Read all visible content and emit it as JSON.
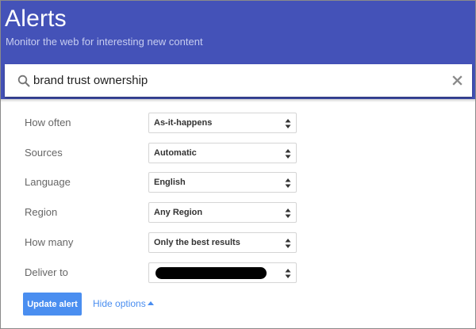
{
  "header": {
    "title": "Alerts",
    "subtitle": "Monitor the web for interesting new content"
  },
  "search": {
    "value": "brand trust ownership",
    "icon": "search-icon",
    "clear_icon": "close-icon"
  },
  "options": [
    {
      "label": "How often",
      "value": "As-it-happens"
    },
    {
      "label": "Sources",
      "value": "Automatic"
    },
    {
      "label": "Language",
      "value": "English"
    },
    {
      "label": "Region",
      "value": "Any Region"
    },
    {
      "label": "How many",
      "value": "Only the best results"
    },
    {
      "label": "Deliver to",
      "value": "",
      "redacted": true
    }
  ],
  "actions": {
    "update_label": "Update alert",
    "hide_options_label": "Hide options"
  },
  "colors": {
    "header": "#4452b8",
    "accent": "#4a8ef0"
  }
}
